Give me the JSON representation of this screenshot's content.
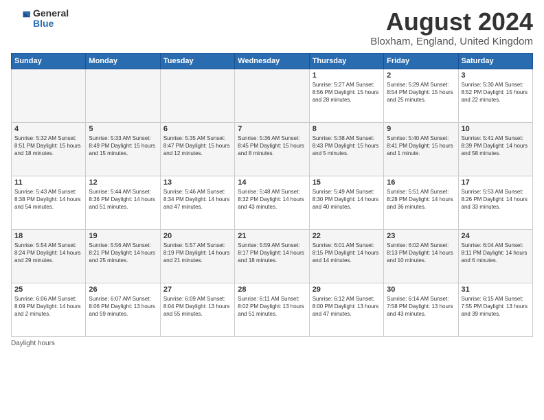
{
  "header": {
    "logo_general": "General",
    "logo_blue": "Blue",
    "month_year": "August 2024",
    "location": "Bloxham, England, United Kingdom"
  },
  "days_of_week": [
    "Sunday",
    "Monday",
    "Tuesday",
    "Wednesday",
    "Thursday",
    "Friday",
    "Saturday"
  ],
  "footer": {
    "note": "Daylight hours"
  },
  "weeks": [
    [
      {
        "day": "",
        "info": ""
      },
      {
        "day": "",
        "info": ""
      },
      {
        "day": "",
        "info": ""
      },
      {
        "day": "",
        "info": ""
      },
      {
        "day": "1",
        "info": "Sunrise: 5:27 AM\nSunset: 8:56 PM\nDaylight: 15 hours\nand 28 minutes."
      },
      {
        "day": "2",
        "info": "Sunrise: 5:29 AM\nSunset: 8:54 PM\nDaylight: 15 hours\nand 25 minutes."
      },
      {
        "day": "3",
        "info": "Sunrise: 5:30 AM\nSunset: 8:52 PM\nDaylight: 15 hours\nand 22 minutes."
      }
    ],
    [
      {
        "day": "4",
        "info": "Sunrise: 5:32 AM\nSunset: 8:51 PM\nDaylight: 15 hours\nand 18 minutes."
      },
      {
        "day": "5",
        "info": "Sunrise: 5:33 AM\nSunset: 8:49 PM\nDaylight: 15 hours\nand 15 minutes."
      },
      {
        "day": "6",
        "info": "Sunrise: 5:35 AM\nSunset: 8:47 PM\nDaylight: 15 hours\nand 12 minutes."
      },
      {
        "day": "7",
        "info": "Sunrise: 5:36 AM\nSunset: 8:45 PM\nDaylight: 15 hours\nand 8 minutes."
      },
      {
        "day": "8",
        "info": "Sunrise: 5:38 AM\nSunset: 8:43 PM\nDaylight: 15 hours\nand 5 minutes."
      },
      {
        "day": "9",
        "info": "Sunrise: 5:40 AM\nSunset: 8:41 PM\nDaylight: 15 hours\nand 1 minute."
      },
      {
        "day": "10",
        "info": "Sunrise: 5:41 AM\nSunset: 8:39 PM\nDaylight: 14 hours\nand 58 minutes."
      }
    ],
    [
      {
        "day": "11",
        "info": "Sunrise: 5:43 AM\nSunset: 8:38 PM\nDaylight: 14 hours\nand 54 minutes."
      },
      {
        "day": "12",
        "info": "Sunrise: 5:44 AM\nSunset: 8:36 PM\nDaylight: 14 hours\nand 51 minutes."
      },
      {
        "day": "13",
        "info": "Sunrise: 5:46 AM\nSunset: 8:34 PM\nDaylight: 14 hours\nand 47 minutes."
      },
      {
        "day": "14",
        "info": "Sunrise: 5:48 AM\nSunset: 8:32 PM\nDaylight: 14 hours\nand 43 minutes."
      },
      {
        "day": "15",
        "info": "Sunrise: 5:49 AM\nSunset: 8:30 PM\nDaylight: 14 hours\nand 40 minutes."
      },
      {
        "day": "16",
        "info": "Sunrise: 5:51 AM\nSunset: 8:28 PM\nDaylight: 14 hours\nand 36 minutes."
      },
      {
        "day": "17",
        "info": "Sunrise: 5:53 AM\nSunset: 8:26 PM\nDaylight: 14 hours\nand 33 minutes."
      }
    ],
    [
      {
        "day": "18",
        "info": "Sunrise: 5:54 AM\nSunset: 8:24 PM\nDaylight: 14 hours\nand 29 minutes."
      },
      {
        "day": "19",
        "info": "Sunrise: 5:56 AM\nSunset: 8:21 PM\nDaylight: 14 hours\nand 25 minutes."
      },
      {
        "day": "20",
        "info": "Sunrise: 5:57 AM\nSunset: 8:19 PM\nDaylight: 14 hours\nand 21 minutes."
      },
      {
        "day": "21",
        "info": "Sunrise: 5:59 AM\nSunset: 8:17 PM\nDaylight: 14 hours\nand 18 minutes."
      },
      {
        "day": "22",
        "info": "Sunrise: 6:01 AM\nSunset: 8:15 PM\nDaylight: 14 hours\nand 14 minutes."
      },
      {
        "day": "23",
        "info": "Sunrise: 6:02 AM\nSunset: 8:13 PM\nDaylight: 14 hours\nand 10 minutes."
      },
      {
        "day": "24",
        "info": "Sunrise: 6:04 AM\nSunset: 8:11 PM\nDaylight: 14 hours\nand 6 minutes."
      }
    ],
    [
      {
        "day": "25",
        "info": "Sunrise: 6:06 AM\nSunset: 8:09 PM\nDaylight: 14 hours\nand 2 minutes."
      },
      {
        "day": "26",
        "info": "Sunrise: 6:07 AM\nSunset: 8:06 PM\nDaylight: 13 hours\nand 59 minutes."
      },
      {
        "day": "27",
        "info": "Sunrise: 6:09 AM\nSunset: 8:04 PM\nDaylight: 13 hours\nand 55 minutes."
      },
      {
        "day": "28",
        "info": "Sunrise: 6:11 AM\nSunset: 8:02 PM\nDaylight: 13 hours\nand 51 minutes."
      },
      {
        "day": "29",
        "info": "Sunrise: 6:12 AM\nSunset: 8:00 PM\nDaylight: 13 hours\nand 47 minutes."
      },
      {
        "day": "30",
        "info": "Sunrise: 6:14 AM\nSunset: 7:58 PM\nDaylight: 13 hours\nand 43 minutes."
      },
      {
        "day": "31",
        "info": "Sunrise: 6:15 AM\nSunset: 7:55 PM\nDaylight: 13 hours\nand 39 minutes."
      }
    ]
  ]
}
